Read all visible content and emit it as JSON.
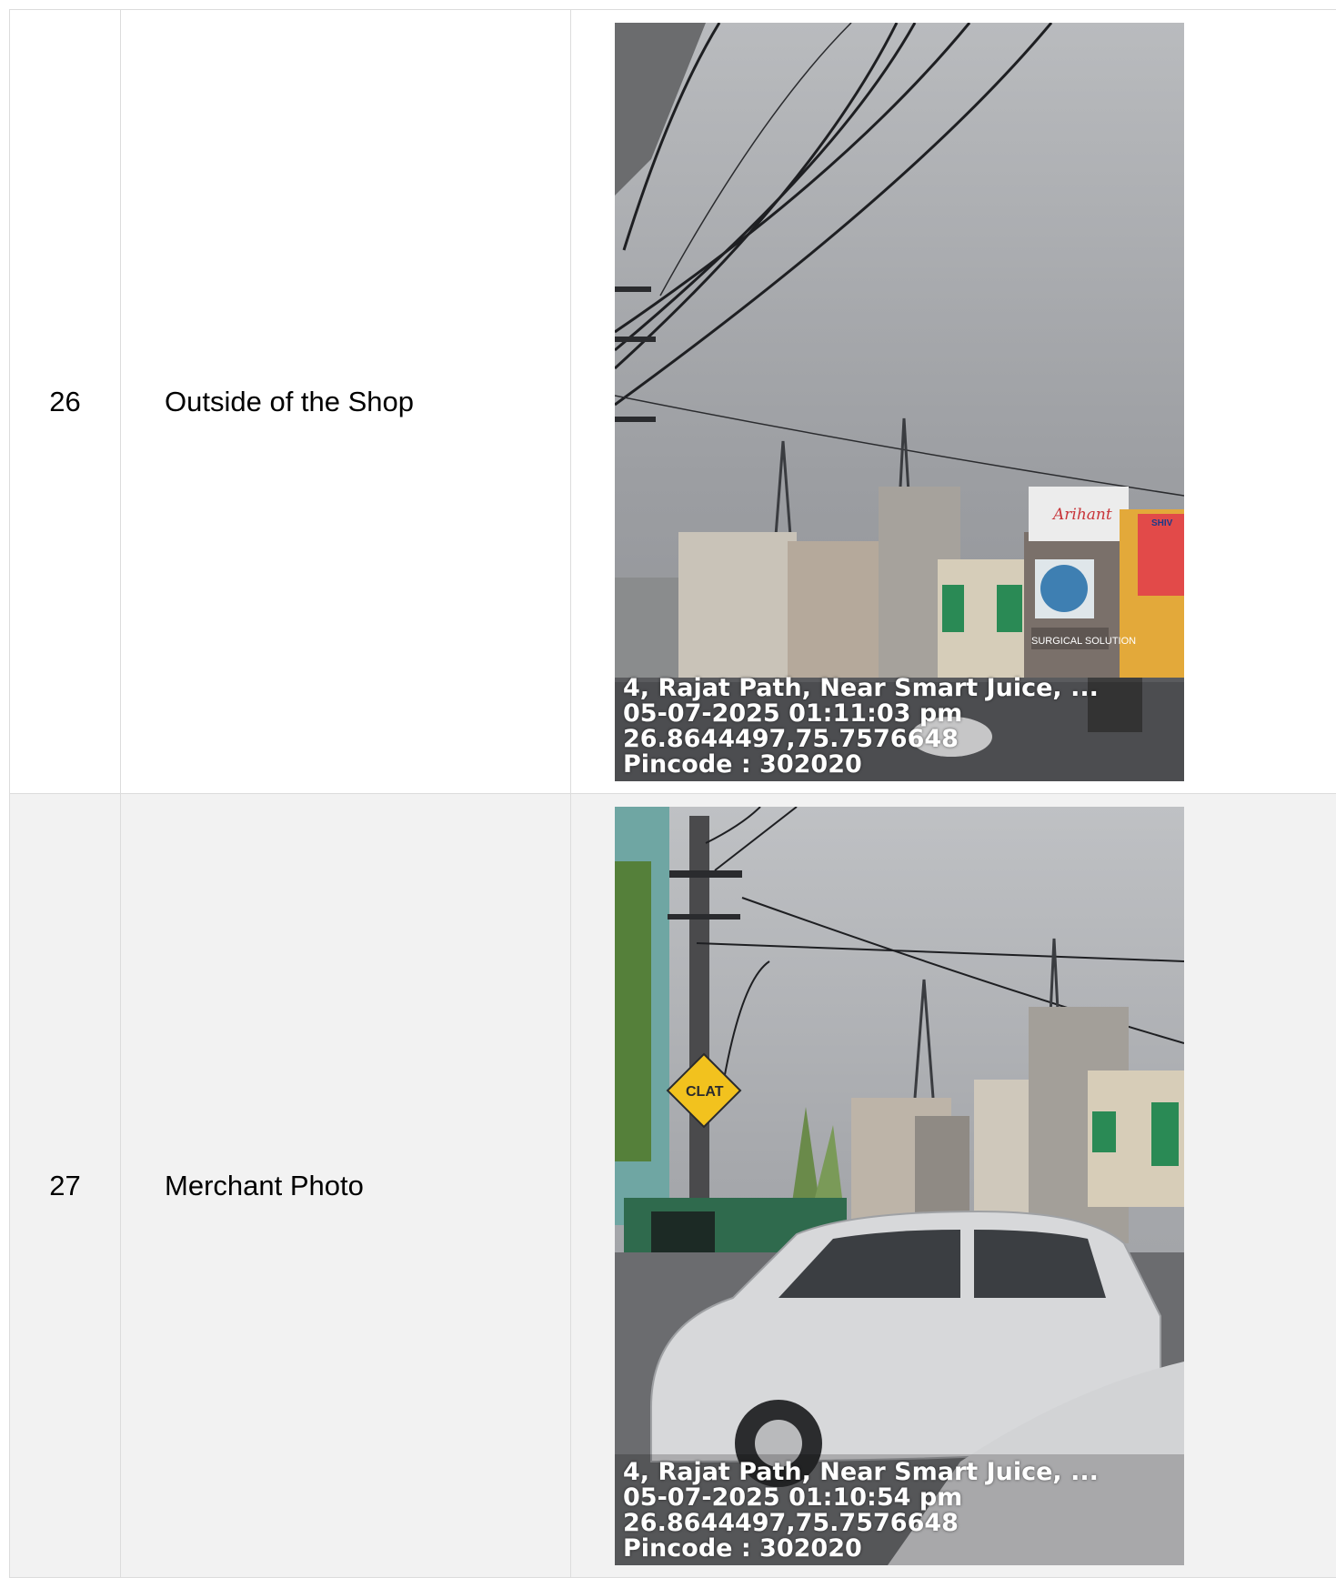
{
  "rows": [
    {
      "number": "26",
      "label": "Outside of the Shop",
      "photo": {
        "address": "4, Rajat Path, Near Smart Juice, ...",
        "datetime": "05-07-2025 01:11:03 pm",
        "coords": "26.8644497,75.7576648",
        "pincode": "Pincode : 302020",
        "signs": [
          "Arihant",
          "SURGICAL SOLUTION",
          "SHIV"
        ]
      }
    },
    {
      "number": "27",
      "label": "Merchant Photo",
      "photo": {
        "address": "4, Rajat Path, Near Smart Juice, ...",
        "datetime": "05-07-2025 01:10:54 pm",
        "coords": "26.8644497,75.7576648",
        "pincode": "Pincode : 302020",
        "signs": [
          "CLAT"
        ]
      }
    }
  ],
  "colors": {
    "row_alt_background": "#f2f2f2",
    "border": "#dcdcdc",
    "sky": "#a9abae"
  }
}
